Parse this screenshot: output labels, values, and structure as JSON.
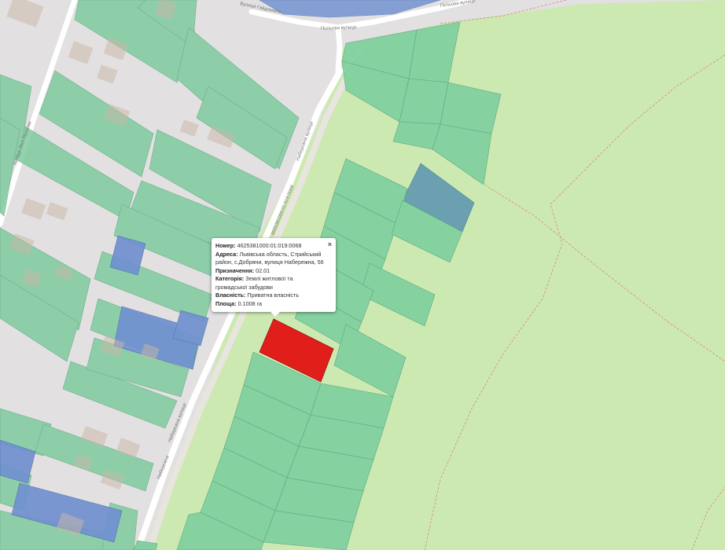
{
  "map": {
    "streets": [
      {
        "id": "street-haydamak",
        "label": "Вулиця Гайдамаків"
      },
      {
        "id": "street-poliska-top",
        "label": "Польова вулиця"
      },
      {
        "id": "street-poliska-mid",
        "label": "Польова вулиця"
      },
      {
        "id": "street-naberezhna-upper",
        "label": "Набережна вулиця"
      },
      {
        "id": "street-naberezhna-mid",
        "label": "Набережна вулиця"
      },
      {
        "id": "street-naberezhna-lower",
        "label": "Набережна"
      },
      {
        "id": "street-left-vertical",
        "label": "вулиця Лесі Українки"
      }
    ],
    "colors": {
      "background": "#e2e0e0",
      "field": "#cde9b2",
      "parcel_private": "#82d0a0",
      "parcel_blue": "#6f8fd0",
      "parcel_selected": "#e01f1a"
    },
    "selected_parcel_label": "4625381000:01:019:0068"
  },
  "popup": {
    "number_label": "Номер:",
    "number_value": "4625381000:01:019:0068",
    "address_label": "Адреса:",
    "address_value": "Львівська область, Стрийський район, с.Добряни, вулиця Набережна, 56",
    "purpose_label": "Призначення:",
    "purpose_value": "02.01",
    "category_label": "Категорія:",
    "category_value": "Землі житлової та громадської забудови",
    "ownership_label": "Власність:",
    "ownership_value": "Приватна власність",
    "area_label": "Площа:",
    "area_value": "0.1008 га",
    "close_label": "×"
  }
}
